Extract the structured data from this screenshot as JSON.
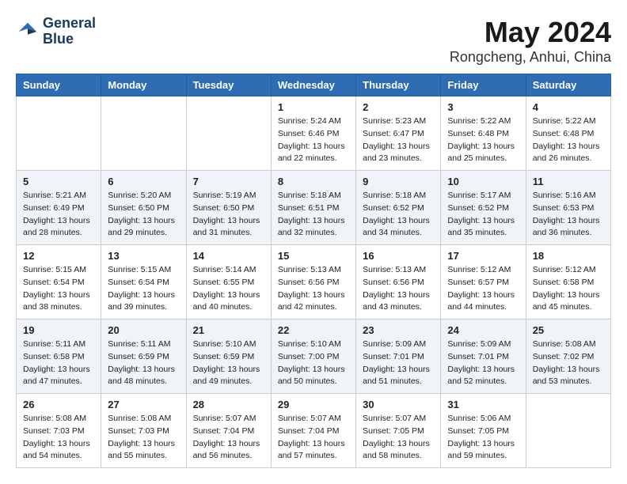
{
  "header": {
    "logo_line1": "General",
    "logo_line2": "Blue",
    "main_title": "May 2024",
    "subtitle": "Rongcheng, Anhui, China"
  },
  "days_of_week": [
    "Sunday",
    "Monday",
    "Tuesday",
    "Wednesday",
    "Thursday",
    "Friday",
    "Saturday"
  ],
  "weeks": [
    [
      {
        "day": "",
        "info": ""
      },
      {
        "day": "",
        "info": ""
      },
      {
        "day": "",
        "info": ""
      },
      {
        "day": "1",
        "info": "Sunrise: 5:24 AM\nSunset: 6:46 PM\nDaylight: 13 hours\nand 22 minutes."
      },
      {
        "day": "2",
        "info": "Sunrise: 5:23 AM\nSunset: 6:47 PM\nDaylight: 13 hours\nand 23 minutes."
      },
      {
        "day": "3",
        "info": "Sunrise: 5:22 AM\nSunset: 6:48 PM\nDaylight: 13 hours\nand 25 minutes."
      },
      {
        "day": "4",
        "info": "Sunrise: 5:22 AM\nSunset: 6:48 PM\nDaylight: 13 hours\nand 26 minutes."
      }
    ],
    [
      {
        "day": "5",
        "info": "Sunrise: 5:21 AM\nSunset: 6:49 PM\nDaylight: 13 hours\nand 28 minutes."
      },
      {
        "day": "6",
        "info": "Sunrise: 5:20 AM\nSunset: 6:50 PM\nDaylight: 13 hours\nand 29 minutes."
      },
      {
        "day": "7",
        "info": "Sunrise: 5:19 AM\nSunset: 6:50 PM\nDaylight: 13 hours\nand 31 minutes."
      },
      {
        "day": "8",
        "info": "Sunrise: 5:18 AM\nSunset: 6:51 PM\nDaylight: 13 hours\nand 32 minutes."
      },
      {
        "day": "9",
        "info": "Sunrise: 5:18 AM\nSunset: 6:52 PM\nDaylight: 13 hours\nand 34 minutes."
      },
      {
        "day": "10",
        "info": "Sunrise: 5:17 AM\nSunset: 6:52 PM\nDaylight: 13 hours\nand 35 minutes."
      },
      {
        "day": "11",
        "info": "Sunrise: 5:16 AM\nSunset: 6:53 PM\nDaylight: 13 hours\nand 36 minutes."
      }
    ],
    [
      {
        "day": "12",
        "info": "Sunrise: 5:15 AM\nSunset: 6:54 PM\nDaylight: 13 hours\nand 38 minutes."
      },
      {
        "day": "13",
        "info": "Sunrise: 5:15 AM\nSunset: 6:54 PM\nDaylight: 13 hours\nand 39 minutes."
      },
      {
        "day": "14",
        "info": "Sunrise: 5:14 AM\nSunset: 6:55 PM\nDaylight: 13 hours\nand 40 minutes."
      },
      {
        "day": "15",
        "info": "Sunrise: 5:13 AM\nSunset: 6:56 PM\nDaylight: 13 hours\nand 42 minutes."
      },
      {
        "day": "16",
        "info": "Sunrise: 5:13 AM\nSunset: 6:56 PM\nDaylight: 13 hours\nand 43 minutes."
      },
      {
        "day": "17",
        "info": "Sunrise: 5:12 AM\nSunset: 6:57 PM\nDaylight: 13 hours\nand 44 minutes."
      },
      {
        "day": "18",
        "info": "Sunrise: 5:12 AM\nSunset: 6:58 PM\nDaylight: 13 hours\nand 45 minutes."
      }
    ],
    [
      {
        "day": "19",
        "info": "Sunrise: 5:11 AM\nSunset: 6:58 PM\nDaylight: 13 hours\nand 47 minutes."
      },
      {
        "day": "20",
        "info": "Sunrise: 5:11 AM\nSunset: 6:59 PM\nDaylight: 13 hours\nand 48 minutes."
      },
      {
        "day": "21",
        "info": "Sunrise: 5:10 AM\nSunset: 6:59 PM\nDaylight: 13 hours\nand 49 minutes."
      },
      {
        "day": "22",
        "info": "Sunrise: 5:10 AM\nSunset: 7:00 PM\nDaylight: 13 hours\nand 50 minutes."
      },
      {
        "day": "23",
        "info": "Sunrise: 5:09 AM\nSunset: 7:01 PM\nDaylight: 13 hours\nand 51 minutes."
      },
      {
        "day": "24",
        "info": "Sunrise: 5:09 AM\nSunset: 7:01 PM\nDaylight: 13 hours\nand 52 minutes."
      },
      {
        "day": "25",
        "info": "Sunrise: 5:08 AM\nSunset: 7:02 PM\nDaylight: 13 hours\nand 53 minutes."
      }
    ],
    [
      {
        "day": "26",
        "info": "Sunrise: 5:08 AM\nSunset: 7:03 PM\nDaylight: 13 hours\nand 54 minutes."
      },
      {
        "day": "27",
        "info": "Sunrise: 5:08 AM\nSunset: 7:03 PM\nDaylight: 13 hours\nand 55 minutes."
      },
      {
        "day": "28",
        "info": "Sunrise: 5:07 AM\nSunset: 7:04 PM\nDaylight: 13 hours\nand 56 minutes."
      },
      {
        "day": "29",
        "info": "Sunrise: 5:07 AM\nSunset: 7:04 PM\nDaylight: 13 hours\nand 57 minutes."
      },
      {
        "day": "30",
        "info": "Sunrise: 5:07 AM\nSunset: 7:05 PM\nDaylight: 13 hours\nand 58 minutes."
      },
      {
        "day": "31",
        "info": "Sunrise: 5:06 AM\nSunset: 7:05 PM\nDaylight: 13 hours\nand 59 minutes."
      },
      {
        "day": "",
        "info": ""
      }
    ]
  ]
}
